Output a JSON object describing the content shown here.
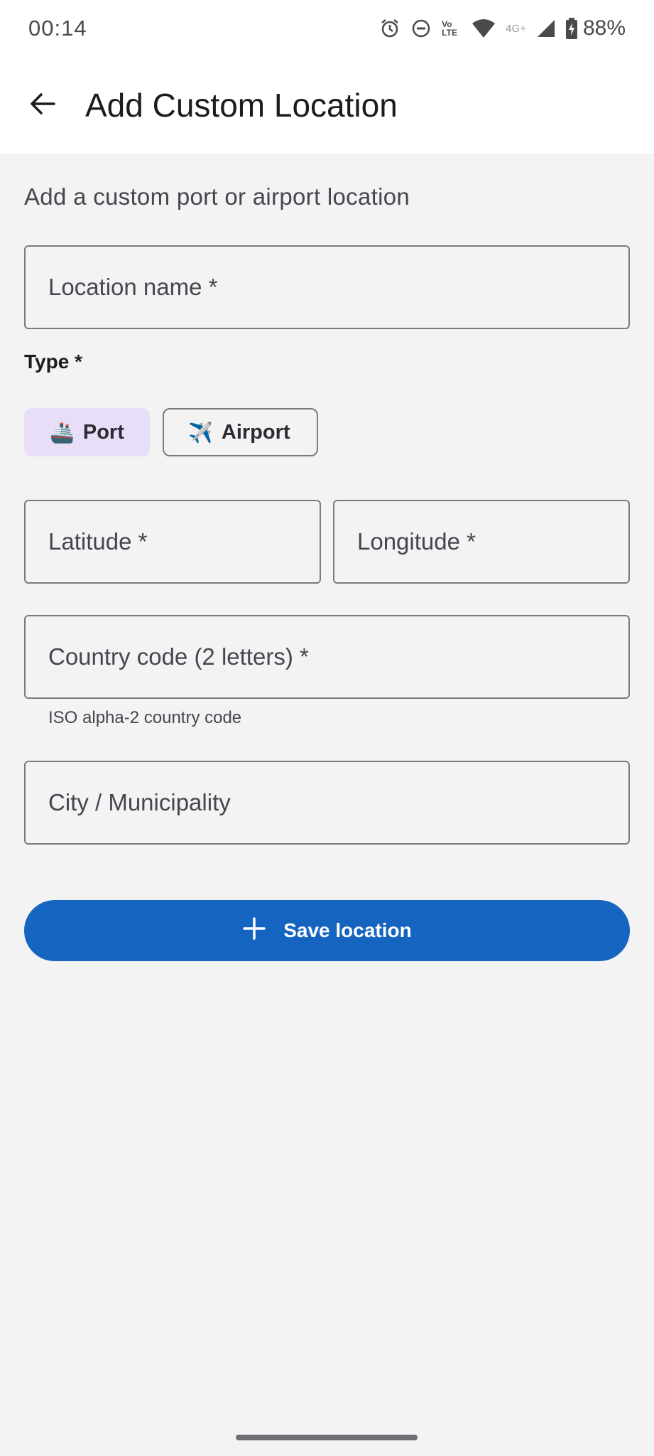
{
  "status_bar": {
    "time": "00:14",
    "network_label": "4G+",
    "volte_label": "Vo LTE",
    "battery_percent": "88%"
  },
  "app_bar": {
    "title": "Add Custom Location",
    "back_icon": "arrow-back-icon"
  },
  "form": {
    "subtitle": "Add a custom port or airport location",
    "location_name": {
      "placeholder": "Location name *",
      "value": ""
    },
    "type_label": "Type *",
    "type_options": [
      {
        "icon": "🚢",
        "icon_name": "ship-icon",
        "label": "Port",
        "selected": true
      },
      {
        "icon": "✈️",
        "icon_name": "airplane-icon",
        "label": "Airport",
        "selected": false
      }
    ],
    "latitude": {
      "placeholder": "Latitude *",
      "value": ""
    },
    "longitude": {
      "placeholder": "Longitude *",
      "value": ""
    },
    "country_code": {
      "placeholder": "Country code (2 letters) *",
      "value": "",
      "helper": "ISO alpha-2 country code"
    },
    "city": {
      "placeholder": "City / Municipality",
      "value": ""
    },
    "save_button": {
      "label": "Save location",
      "icon": "plus-icon"
    }
  },
  "colors": {
    "primary": "#1565c0",
    "chip_selected": "#e8def8",
    "background": "#f3f3f4"
  }
}
